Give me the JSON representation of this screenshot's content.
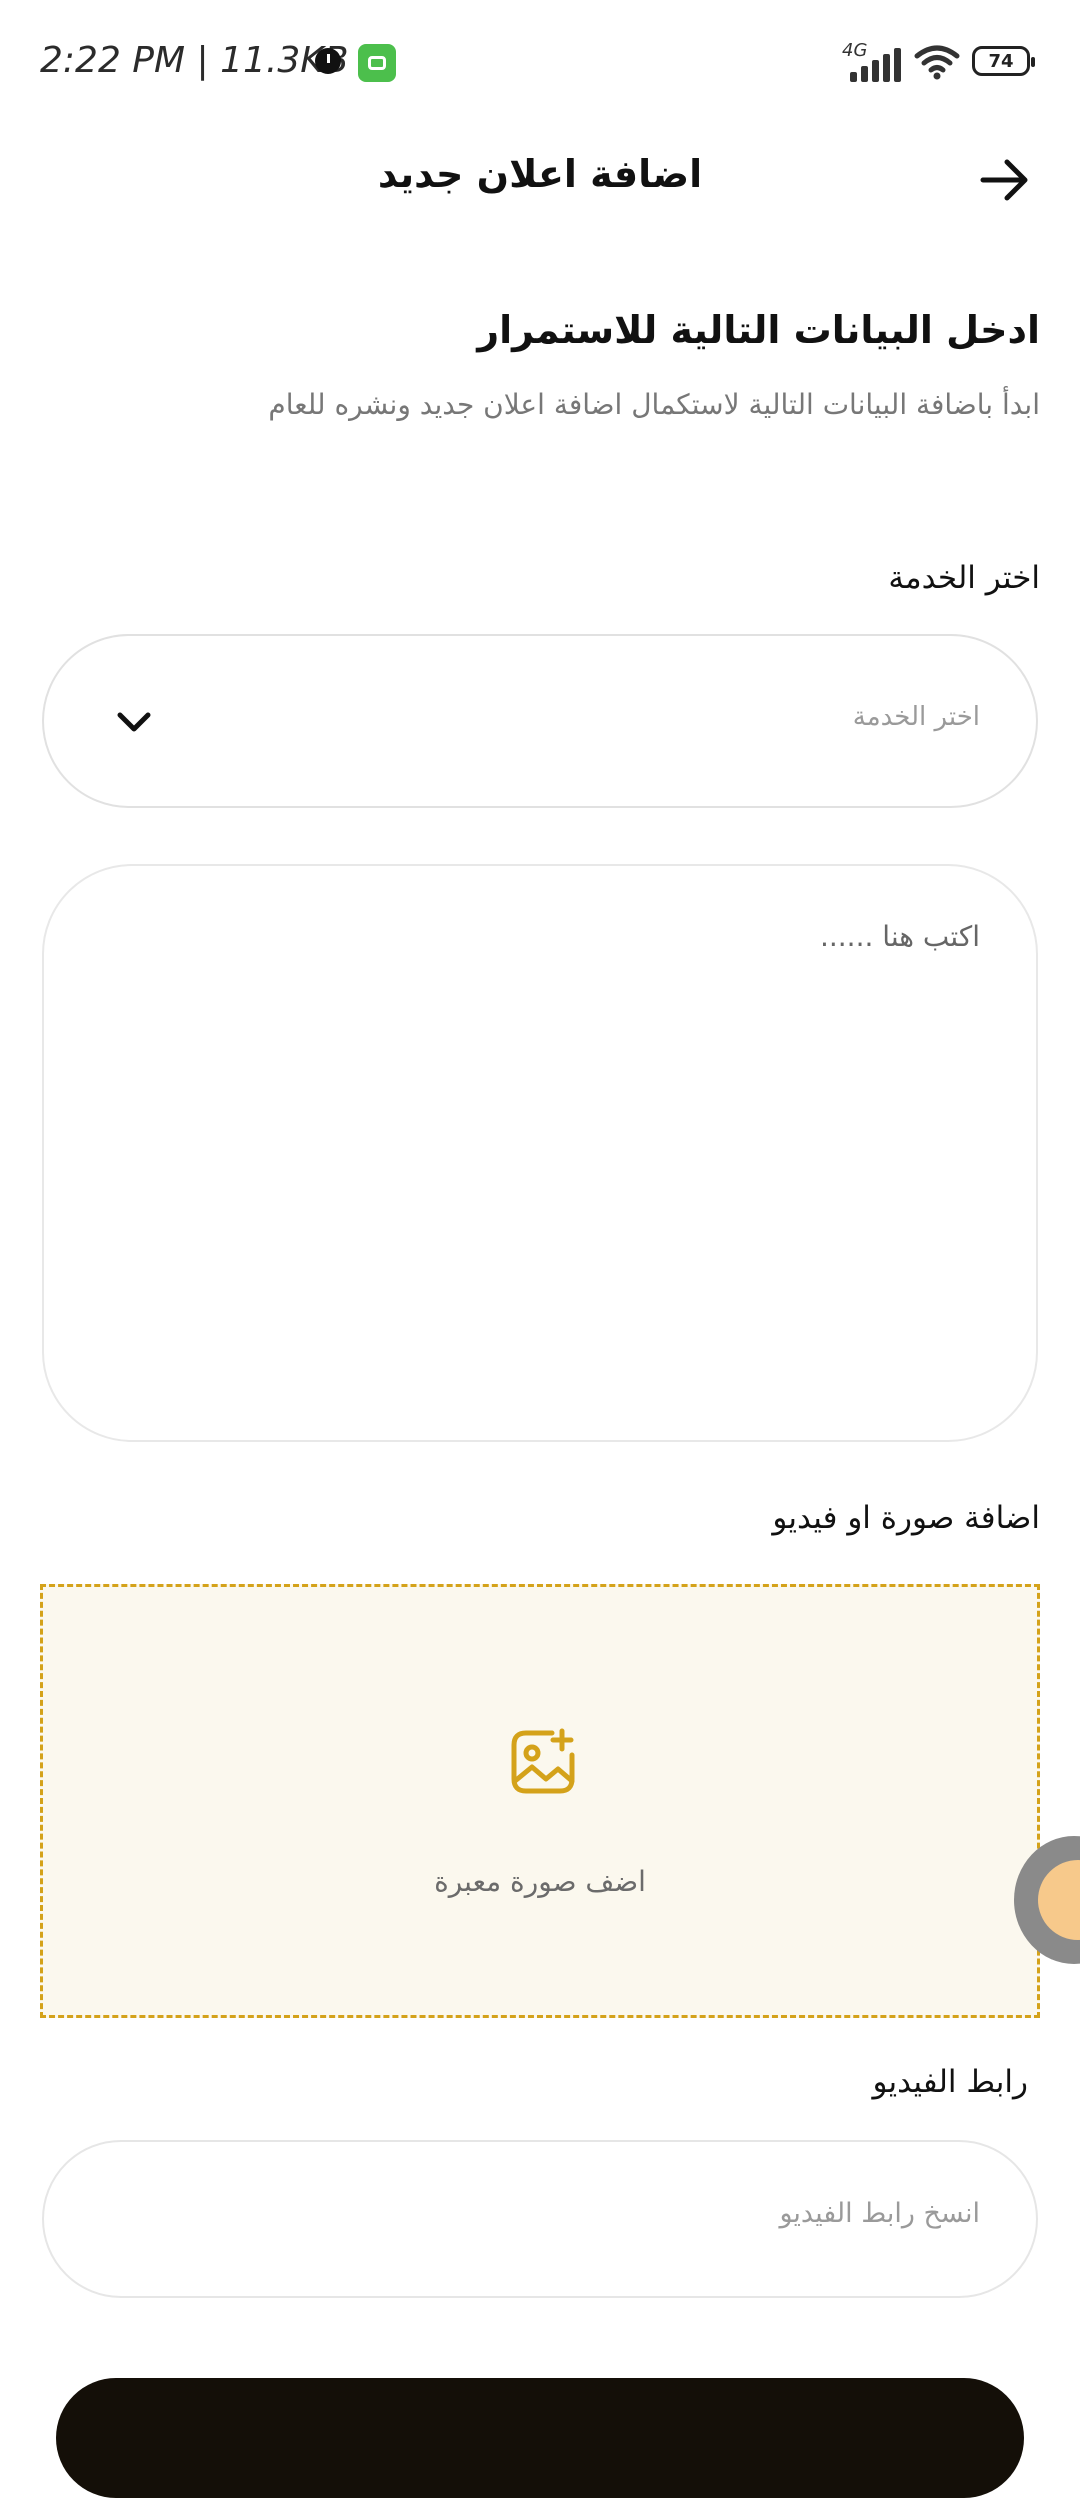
{
  "status_bar": {
    "time_speed": "2:22 PM | 11.3KB",
    "network": "4G",
    "battery": "74",
    "icons": [
      "alarm-icon",
      "app-notification-icon",
      "signal-icon",
      "wifi-icon",
      "battery-icon"
    ]
  },
  "header": {
    "title": "اضافة اعلان جديد",
    "back_icon": "arrow-right-icon"
  },
  "intro": {
    "heading": "ادخل البيانات التالية للاستمرار",
    "subtext": "ابدأ باضافة البيانات التالية لاستكمال اضافة اعلان جديد ونشره للعام"
  },
  "service": {
    "label": "اختر الخدمة",
    "placeholder": "اختر الخدمة",
    "icon": "chevron-down-icon"
  },
  "description": {
    "placeholder": "اكتب هنا ......"
  },
  "media": {
    "label": "اضافة صورة او فيديو",
    "upload_text": "اضف صورة  معبرة",
    "icon": "image-add-icon",
    "accent_color": "#d4a21a",
    "background_color": "#fbf8ee"
  },
  "video_link": {
    "label": "رابط الفيديو",
    "placeholder": "انسخ رابط الفيديو"
  },
  "colors": {
    "primary_button": "#140f08",
    "accent": "#d4a21a"
  }
}
